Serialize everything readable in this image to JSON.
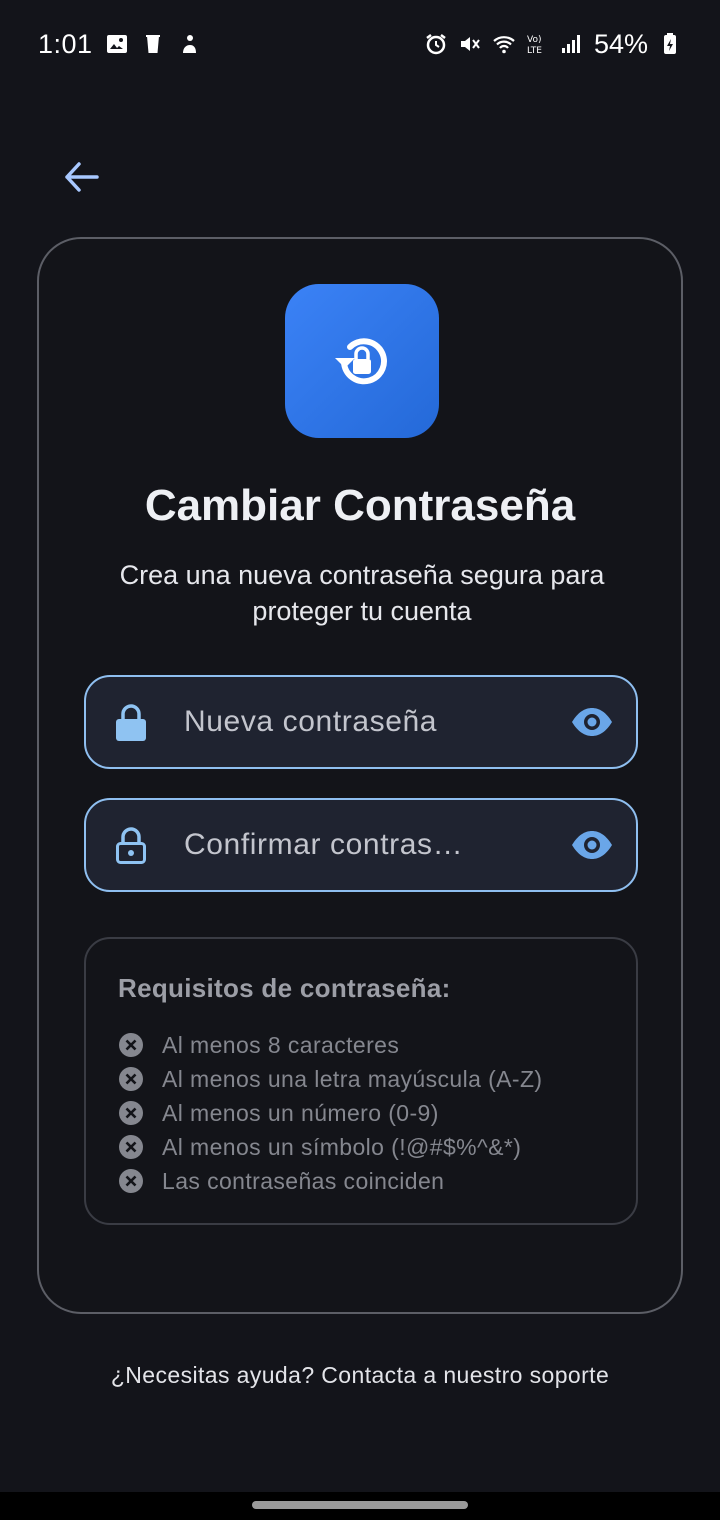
{
  "status_bar": {
    "time": "1:01",
    "battery": "54%",
    "left_icons": [
      "gallery-icon",
      "trash-icon",
      "person-icon"
    ],
    "right_icons": [
      "alarm-icon",
      "mute-icon",
      "wifi-icon",
      "volte-icon",
      "signal-icon",
      "battery-charging-icon"
    ]
  },
  "nav": {
    "back_icon": "arrow-left-icon"
  },
  "card": {
    "icon": "lock-reset-icon",
    "title": "Cambiar Contraseña",
    "subtitle": "Crea una nueva contraseña segura para proteger tu cuenta",
    "new_password": {
      "placeholder": "Nueva contraseña",
      "value": ""
    },
    "confirm_password": {
      "placeholder": "Confirmar contras…",
      "value": ""
    },
    "requirements": {
      "title": "Requisitos de contraseña:",
      "items": [
        "Al menos 8 caracteres",
        "Al menos una letra mayúscula (A-Z)",
        "Al menos un número (0-9)",
        "Al menos un símbolo (!@#$%^&*)",
        "Las contraseñas coinciden"
      ]
    }
  },
  "help_text": "¿Necesitas ayuda? Contacta a nuestro soporte",
  "colors": {
    "accent": "#3b82f6",
    "field_border": "#8fbff0",
    "background": "#13141a"
  }
}
